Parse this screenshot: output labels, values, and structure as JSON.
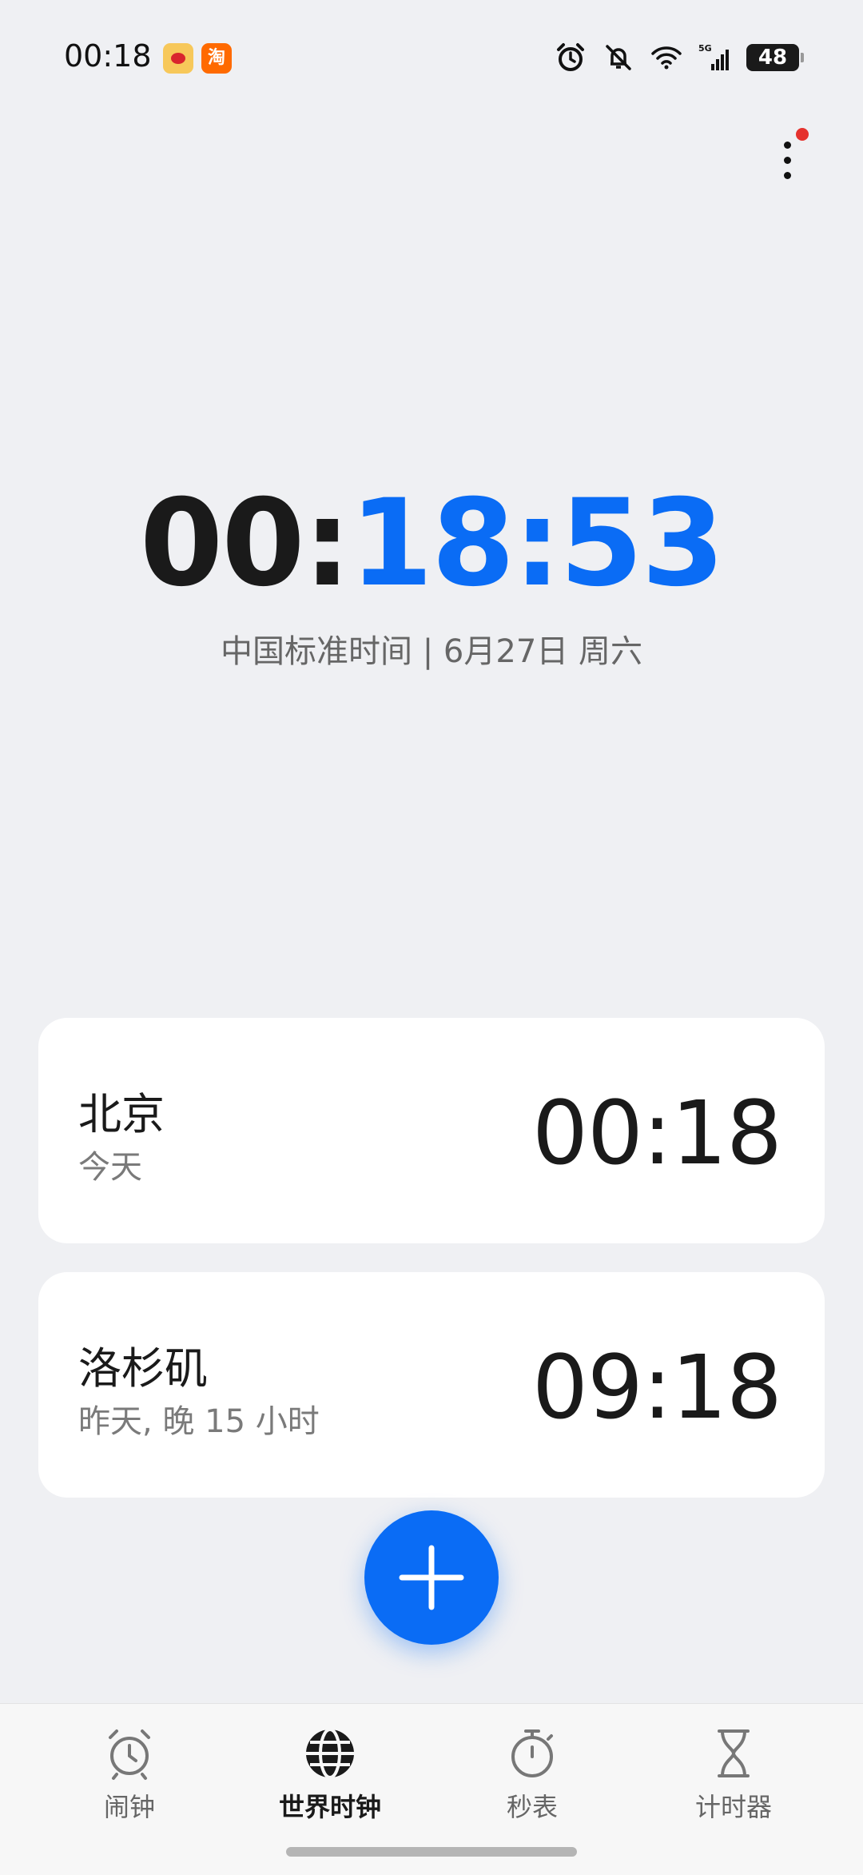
{
  "status_bar": {
    "time": "00:18",
    "battery": "48",
    "network": "5G",
    "apps": [
      "weibo-icon",
      "taobao-icon"
    ],
    "taobao_label": "淘"
  },
  "clock": {
    "hours": "00:",
    "minutes_seconds": "18:53",
    "info": "中国标准时间 | 6月27日  周六",
    "accent_color": "#0a6cf5"
  },
  "cities": [
    {
      "name": "北京",
      "sub": "今天",
      "time": "00:18"
    },
    {
      "name": "洛杉矶",
      "sub": "昨天, 晚 15 小时",
      "time": "09:18"
    }
  ],
  "nav": {
    "items": [
      {
        "label": "闹钟",
        "icon": "alarm-icon",
        "active": false
      },
      {
        "label": "世界时钟",
        "icon": "globe-icon",
        "active": true
      },
      {
        "label": "秒表",
        "icon": "stopwatch-icon",
        "active": false
      },
      {
        "label": "计时器",
        "icon": "hourglass-icon",
        "active": false
      }
    ]
  }
}
